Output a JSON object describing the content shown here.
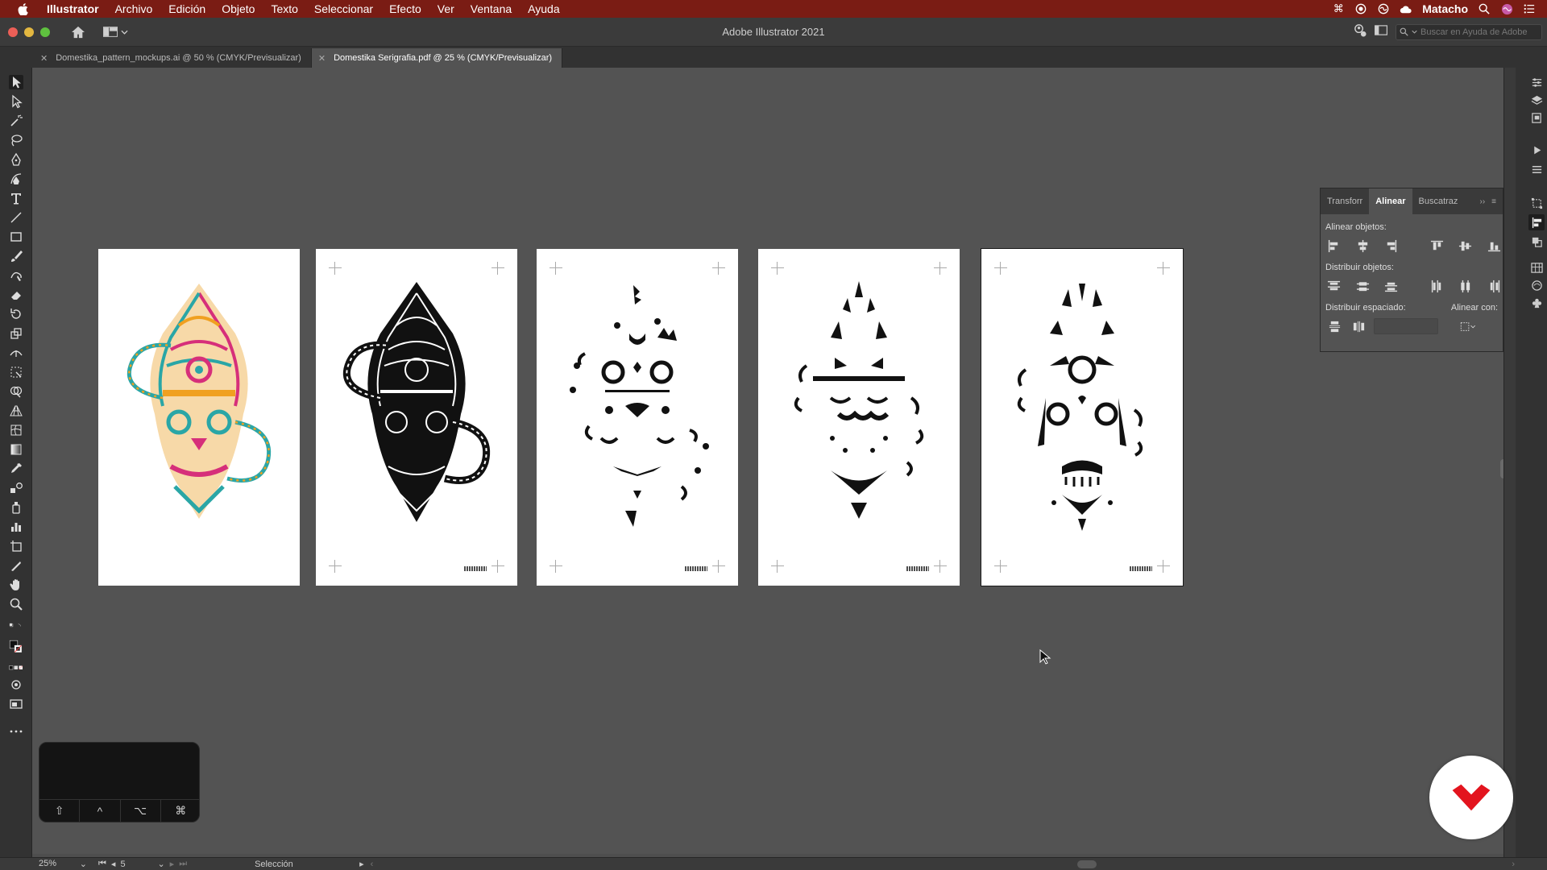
{
  "menubar": {
    "app_name": "Illustrator",
    "items": [
      "Archivo",
      "Edición",
      "Objeto",
      "Texto",
      "Seleccionar",
      "Efecto",
      "Ver",
      "Ventana",
      "Ayuda"
    ],
    "user": "Matacho"
  },
  "window": {
    "title": "Adobe Illustrator 2021",
    "help_search_placeholder": "Buscar en Ayuda de Adobe"
  },
  "tabs": [
    {
      "label": "Domestika_pattern_mockups.ai @ 50 % (CMYK/Previsualizar)",
      "active": false
    },
    {
      "label": "Domestika Serigrafia.pdf @ 25 % (CMYK/Previsualizar)",
      "active": true
    }
  ],
  "tools": [
    "selection-tool",
    "direct-selection-tool",
    "magic-wand-tool",
    "lasso-tool",
    "pen-tool",
    "curvature-tool",
    "type-tool",
    "line-tool",
    "rectangle-tool",
    "paintbrush-tool",
    "shaper-tool",
    "eraser-tool",
    "rotate-tool",
    "scale-tool",
    "width-tool",
    "free-transform-tool",
    "shape-builder-tool",
    "perspective-grid-tool",
    "mesh-tool",
    "gradient-tool",
    "eyedropper-tool",
    "blend-tool",
    "symbol-sprayer-tool",
    "column-graph-tool",
    "artboard-tool",
    "slice-tool",
    "hand-tool",
    "zoom-tool"
  ],
  "align_panel": {
    "tabs": [
      "Transforr",
      "Alinear",
      "Buscatraz"
    ],
    "active_tab": "Alinear",
    "align_objects_label": "Alinear objetos:",
    "distribute_objects_label": "Distribuir objetos:",
    "distribute_spacing_label": "Distribuir espaciado:",
    "align_to_label": "Alinear con:"
  },
  "artboards": [
    {
      "name": "artboard-color",
      "style": "color"
    },
    {
      "name": "artboard-black-full",
      "style": "black"
    },
    {
      "name": "artboard-separation-1",
      "style": "sep1"
    },
    {
      "name": "artboard-separation-2",
      "style": "sep2"
    },
    {
      "name": "artboard-separation-3",
      "style": "sep3",
      "selected": true
    }
  ],
  "touchbar": {
    "keys": [
      "⇧",
      "^",
      "⌥",
      "⌘"
    ]
  },
  "status": {
    "zoom": "25%",
    "page": "5",
    "tool": "Selección"
  },
  "colors": {
    "menubar": "#7a1c14",
    "canvas": "#535353",
    "brand": "#e3141e",
    "pink": "#d62f7a",
    "teal": "#2aa6a6",
    "orange": "#f0a020"
  }
}
